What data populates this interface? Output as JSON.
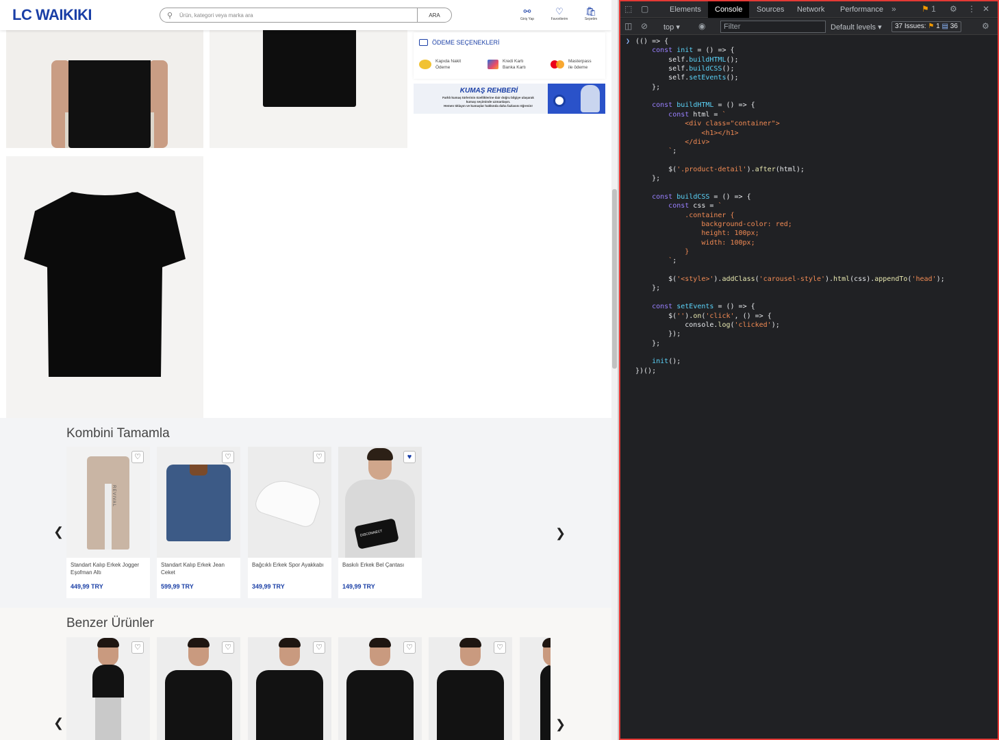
{
  "header": {
    "logo": "LC WAIKIKI",
    "search_placeholder": "Ürün, kategori veya marka ara",
    "search_button": "ARA",
    "actions": [
      {
        "label": "Giriş Yap",
        "icon": "user-icon"
      },
      {
        "label": "Favorilerim",
        "icon": "heart-icon"
      },
      {
        "label": "Sepetim",
        "icon": "bag-icon"
      }
    ]
  },
  "payment": {
    "title": "ÖDEME SEÇENEKLERİ",
    "options": [
      {
        "line1": "Kapıda Nakit",
        "line2": "Ödeme",
        "icon": "coins-icon"
      },
      {
        "line1": "Kredi Kartı",
        "line2": "Banka Kartı",
        "icon": "credit-card-icon"
      },
      {
        "line1": "Masterpass",
        "line2": "ile ödeme",
        "icon": "masterpass-icon"
      }
    ]
  },
  "banner": {
    "title": "KUMAŞ REHBERİ",
    "text_lines": [
      "Farklı kumaş türlerinin özelliklerine dair doğru bilgiye ulaşarak",
      "kumaş seçiminde uzmanlaşın.",
      "Hemen tıklayın ve kumaşlar hakkında daha fazlasını öğrenin!"
    ]
  },
  "kombin": {
    "title": "Kombini Tamamla",
    "products": [
      {
        "name": "Standart Kalıp Erkek Jogger Eşofman Altı",
        "price": "449,99 TRY",
        "favorite": false
      },
      {
        "name": "Standart Kalıp Erkek Jean Ceket",
        "price": "599,99 TRY",
        "favorite": false
      },
      {
        "name": "Bağcıklı Erkek Spor Ayakkabı",
        "price": "349,99 TRY",
        "favorite": false
      },
      {
        "name": "Baskılı Erkek Bel Çantası",
        "price": "149,99 TRY",
        "favorite": true
      }
    ],
    "jogger_print": "REVIVAL",
    "bag_print": "DISCONNECT"
  },
  "benzer": {
    "title": "Benzer Ürünler",
    "item_count_visible": 6
  },
  "devtools": {
    "tabs": [
      "Elements",
      "Console",
      "Sources",
      "Network",
      "Performance"
    ],
    "active_tab": "Console",
    "warning_count": "1",
    "context": "top",
    "filter_placeholder": "Filter",
    "levels": "Default levels",
    "issues_label": "37 Issues:",
    "issues_warn": "1",
    "issues_info": "36",
    "code_lines": [
      "(() => {",
      "    const init = () => {",
      "        self.buildHTML();",
      "        self.buildCSS();",
      "        self.setEvents();",
      "    };",
      "",
      "    const buildHTML = () => {",
      "        const html = `",
      "            <div class=\"container\">",
      "                <h1></h1>",
      "            </div>",
      "        `;",
      "",
      "        $('.product-detail').after(html);",
      "    };",
      "",
      "    const buildCSS = () => {",
      "        const css = `",
      "            .container {",
      "                background-color: red;",
      "                height: 100px;",
      "                width: 100px;",
      "            }",
      "        `;",
      "",
      "        $('<style>').addClass('carousel-style').html(css).appendTo('head');",
      "    };",
      "",
      "    const setEvents = () => {",
      "        $('').on('click', () => {",
      "            console.log('clicked');",
      "        });",
      "    };",
      "",
      "    init();",
      "})();"
    ]
  },
  "colors": {
    "brand": "#1a3fa6",
    "devtools_border": "#e53935",
    "devtools_bg": "#202124"
  }
}
